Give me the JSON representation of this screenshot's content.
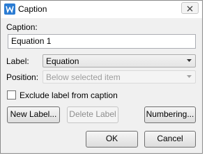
{
  "window": {
    "title": "Caption",
    "close_label": "×"
  },
  "form": {
    "caption_label": "Caption:",
    "caption_value": "Equation 1",
    "label_label": "Label:",
    "label_value": "Equation",
    "position_label": "Position:",
    "position_value": "Below selected item",
    "exclude_label": "Exclude label from caption",
    "exclude_checked": false
  },
  "buttons": {
    "new_label": "New Label...",
    "delete_label": "Delete Label",
    "numbering": "Numbering...",
    "ok": "OK",
    "cancel": "Cancel"
  },
  "colors": {
    "app_icon": "#2b7cd3",
    "dialog_bg": "#f0f0f0"
  }
}
